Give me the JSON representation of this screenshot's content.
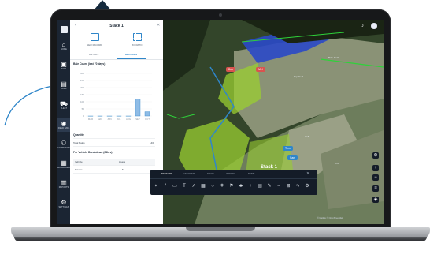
{
  "panel": {
    "title": "Stack 1",
    "tools": [
      {
        "label": "NEW RECORD",
        "icon": "document-icon"
      },
      {
        "label": "ZOOM TO",
        "icon": "zoom-fit-icon"
      }
    ],
    "tabs": [
      "DETAILS",
      "RECORDS"
    ],
    "chart_title": "Bale Count (last 70 days)",
    "rows": [
      {
        "key": "Quantity",
        "value": ""
      },
      {
        "key": "Total Bales",
        "value": "146"
      }
    ],
    "breakdown_title": "Per Vehicle Breakdown (24hrs)",
    "table_headers": [
      "Vehicle",
      "Loads",
      ""
    ],
    "table_rows": [
      [
        "Tractor",
        "5",
        ""
      ]
    ]
  },
  "nav": {
    "items": [
      {
        "label": "HOME",
        "icon": "home-icon"
      },
      {
        "label": "MAP",
        "icon": "map-icon"
      },
      {
        "label": "JOBS",
        "icon": "jobs-icon"
      },
      {
        "label": "FLEET",
        "icon": "truck-icon"
      },
      {
        "label": "FIELD DATA",
        "icon": "field-icon"
      },
      {
        "label": "COMMUNITY",
        "icon": "people-icon"
      },
      {
        "label": "DASHBOARD",
        "icon": "dashboard-icon"
      },
      {
        "label": "REPORTS",
        "icon": "reports-icon"
      },
      {
        "label": "SETTINGS",
        "icon": "gear-icon"
      }
    ]
  },
  "map": {
    "selected_label": "Stack 1",
    "tags": [
      "Bob",
      "Mel",
      "Tom",
      "Sam"
    ],
    "field_labels": [
      "Bale Field",
      "Top Field",
      "C15",
      "C16"
    ],
    "toolbar_tabs": [
      "MEASURE",
      "ANNOTATE",
      "DRAW",
      "IMPORT",
      "MORE"
    ],
    "attribution": "© Mapbox © OpenStreetMap"
  },
  "chart_data": {
    "type": "bar",
    "title": "Bale Count (last 70 days)",
    "categories": [
      "MAR",
      "MAY",
      "JUN",
      "JUL",
      "AUG",
      "SEP",
      "OCT"
    ],
    "values": [
      0,
      0,
      0,
      0,
      0,
      120,
      30
    ],
    "ylim": [
      0,
      300
    ],
    "ticks": [
      "300",
      "250",
      "200",
      "150",
      "100",
      "50",
      "0"
    ],
    "xlabel": "",
    "ylabel": ""
  },
  "colors": {
    "accent": "#2f86c9",
    "nav_bg": "#1b2533",
    "field_green": "#9acd32",
    "field_blue": "#2a49c8",
    "tag_red": "#d9534f"
  }
}
